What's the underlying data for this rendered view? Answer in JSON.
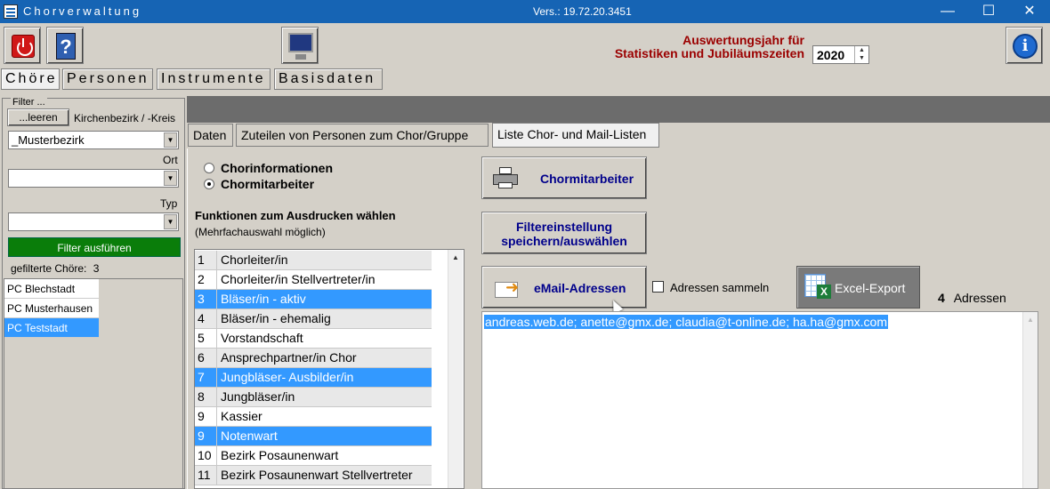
{
  "window": {
    "title": "Chorverwaltung",
    "version": "Vers.: 19.72.20.3451",
    "minimize": "—",
    "maximize": "☐",
    "close": "✕"
  },
  "header": {
    "year_label_line1": "Auswertungsjahr für",
    "year_label_line2": "Statistiken und Jubiläumszeiten",
    "year_value": "2020"
  },
  "main_tabs": [
    "Chöre",
    "Personen",
    "Instrumente",
    "Basisdaten"
  ],
  "filter": {
    "legend": "Filter ...",
    "clear_button": "...leeren",
    "district_label": "Kirchenbezirk / -Kreis",
    "district_value": "_Musterbezirk",
    "ort_label": "Ort",
    "ort_value": "",
    "typ_label": "Typ",
    "typ_value": "",
    "apply_button": "Filter ausführen",
    "count_label": "gefilterte Chöre:",
    "count_value": "3",
    "choirs": [
      {
        "label": "PC Blechstadt",
        "selected": false
      },
      {
        "label": "PC Musterhausen",
        "selected": false
      },
      {
        "label": "PC Teststadt",
        "selected": true
      }
    ]
  },
  "sub_tabs": [
    "Daten",
    "Zuteilen von Personen zum Chor/Gruppe",
    "Liste Chor- und Mail-Listen"
  ],
  "options": {
    "radio1": "Chorinformationen",
    "radio2": "Chormitarbeiter",
    "selected": "Chormitarbeiter",
    "functions_heading": "Funktionen zum Ausdrucken wählen",
    "functions_sub": "(Mehrfachauswahl möglich)"
  },
  "functions": [
    {
      "num": "1",
      "label": "Chorleiter/in",
      "selected": false
    },
    {
      "num": "2",
      "label": "Chorleiter/in  Stellvertreter/in",
      "selected": false
    },
    {
      "num": "3",
      "label": "Bläser/in - aktiv",
      "selected": true
    },
    {
      "num": "4",
      "label": "Bläser/in - ehemalig",
      "selected": false
    },
    {
      "num": "5",
      "label": "Vorstandschaft",
      "selected": false
    },
    {
      "num": "6",
      "label": "Ansprechpartner/in Chor",
      "selected": false
    },
    {
      "num": "7",
      "label": "Jungbläser- Ausbilder/in",
      "selected": true
    },
    {
      "num": "8",
      "label": "Jungbläser/in",
      "selected": false
    },
    {
      "num": "9",
      "label": "Kassier",
      "selected": false
    },
    {
      "num": "9",
      "label": "Notenwart",
      "selected": true
    },
    {
      "num": "10",
      "label": "Bezirk Posaunenwart",
      "selected": false
    },
    {
      "num": "11",
      "label": "Bezirk Posaunenwart  Stellvertreter",
      "selected": false
    }
  ],
  "actions": {
    "print_button": "Chormitarbeiter",
    "filter_button_line1": "Filtereinstellung",
    "filter_button_line2": "speichern/auswählen",
    "email_button": "eMail-Adressen",
    "collect_label": "Adressen sammeln",
    "excel_button": "Excel-Export",
    "address_count": "4",
    "address_label": "Adressen"
  },
  "email_text": "andreas.web.de; anette@gmx.de; claudia@t-online.de; ha.ha@gmx.com",
  "icons": {
    "power": "power-icon",
    "help": "help-book-icon",
    "monitor": "monitor-icon",
    "info": "info-icon",
    "printer": "printer-icon",
    "mail": "mail-icon",
    "excel": "excel-icon"
  },
  "colors": {
    "titlebar": "#1664b4",
    "selection": "#3399ff",
    "apply_button": "#0a7d0a",
    "year_label": "#9b0000",
    "action_text": "#00008b"
  }
}
